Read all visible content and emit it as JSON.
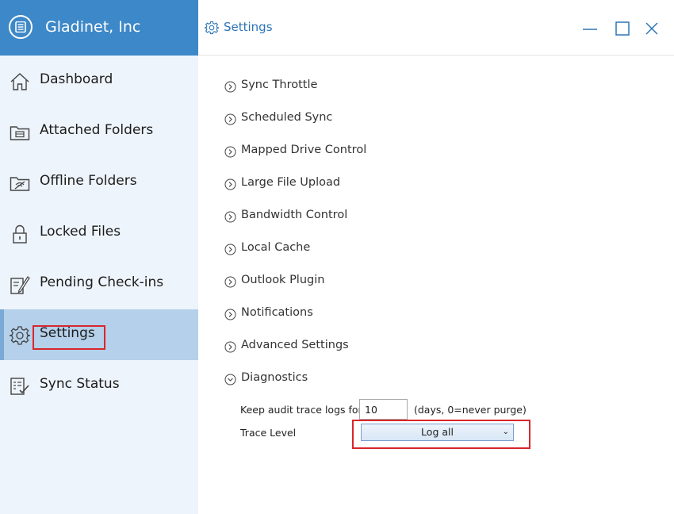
{
  "app": {
    "title": "Gladinet, Inc"
  },
  "sidebar": {
    "items": [
      {
        "label": "Dashboard",
        "icon": "home-icon"
      },
      {
        "label": "Attached Folders",
        "icon": "attached-folder-icon"
      },
      {
        "label": "Offline Folders",
        "icon": "offline-folder-icon"
      },
      {
        "label": "Locked Files",
        "icon": "lock-icon"
      },
      {
        "label": "Pending Check-ins",
        "icon": "pending-checkin-icon"
      },
      {
        "label": "Settings",
        "icon": "gear-icon",
        "active": true
      },
      {
        "label": "Sync Status",
        "icon": "sync-status-icon"
      }
    ]
  },
  "header": {
    "title": "Settings"
  },
  "settings": {
    "sections": [
      {
        "label": "Sync Throttle",
        "expanded": false
      },
      {
        "label": "Scheduled Sync",
        "expanded": false
      },
      {
        "label": "Mapped Drive Control",
        "expanded": false
      },
      {
        "label": "Large File Upload",
        "expanded": false
      },
      {
        "label": "Bandwidth Control",
        "expanded": false
      },
      {
        "label": "Local Cache",
        "expanded": false
      },
      {
        "label": "Outlook Plugin",
        "expanded": false
      },
      {
        "label": "Notifications",
        "expanded": false
      },
      {
        "label": "Advanced Settings",
        "expanded": false
      },
      {
        "label": "Diagnostics",
        "expanded": true
      }
    ],
    "diagnostics": {
      "audit_label": "Keep audit trace logs for",
      "audit_value": "10",
      "audit_hint": "(days, 0=never purge)",
      "trace_label": "Trace Level",
      "trace_value": "Log all"
    }
  },
  "colors": {
    "brand": "#3d88c8",
    "accent": "#2e75b6",
    "highlight": "#d9262c",
    "active_nav": "#b4d0ea"
  }
}
